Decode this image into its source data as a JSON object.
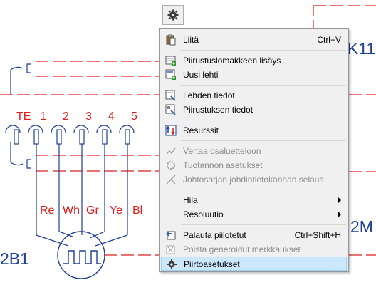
{
  "drawing": {
    "top_labels": [
      "TE",
      "1",
      "2",
      "3",
      "4",
      "5"
    ],
    "wire_labels": [
      "Re",
      "Wh",
      "Gr",
      "Ye",
      "Bl"
    ],
    "left_tag": "2B1",
    "right_tag_top": "K11",
    "right_tag_bottom": "2M"
  },
  "context_menu": {
    "items": [
      {
        "name": "menu-item-paste",
        "icon": "paste-icon",
        "label": "Liitä",
        "shortcut": "Ctrl+V",
        "enabled": true
      },
      {
        "name": "menu-item-add-drawing-form",
        "icon": "add-form-icon",
        "label": "Piirustuslomakkeen lisäys",
        "enabled": true
      },
      {
        "name": "menu-item-new-sheet",
        "icon": "new-sheet-icon",
        "label": "Uusi lehti",
        "enabled": true
      },
      {
        "name": "menu-item-sheet-info",
        "icon": "sheet-info-icon",
        "label": "Lehden tiedot",
        "enabled": true
      },
      {
        "name": "menu-item-drawing-info",
        "icon": "drawing-info-icon",
        "label": "Piirustuksen tiedot",
        "enabled": true
      },
      {
        "name": "menu-item-resources",
        "icon": "resources-icon",
        "label": "Resurssit",
        "enabled": true
      },
      {
        "name": "menu-item-compare-subarea",
        "icon": "compare-icon",
        "label": "Vertaa osaluetteloon",
        "enabled": false
      },
      {
        "name": "menu-item-production-settings",
        "icon": "production-settings-icon",
        "label": "Tuotannon asetukset",
        "enabled": false
      },
      {
        "name": "menu-item-harness-browse",
        "icon": "harness-icon",
        "label": "Johtosarjan johdintietokannan selaus",
        "enabled": false
      },
      {
        "name": "menu-item-grid",
        "label": "Hila",
        "submenu": true,
        "enabled": true
      },
      {
        "name": "menu-item-resolution",
        "label": "Resoluutio",
        "submenu": true,
        "enabled": true
      },
      {
        "name": "menu-item-restore-hidden",
        "icon": "restore-icon",
        "label": "Palauta piilotetut",
        "shortcut": "Ctrl+Shift+H",
        "enabled": true
      },
      {
        "name": "menu-item-remove-generated-marks",
        "icon": "remove-marks-icon",
        "label": "Poista generoidut merkkaukset",
        "enabled": false
      },
      {
        "name": "menu-item-drawing-settings",
        "icon": "gear-icon",
        "label": "Piirtoasetukset",
        "enabled": true,
        "highlighted": true
      }
    ]
  },
  "colors": {
    "wire": "#1f3f9a",
    "dash": "#e01c1c",
    "highlight": "#cce8ff"
  }
}
